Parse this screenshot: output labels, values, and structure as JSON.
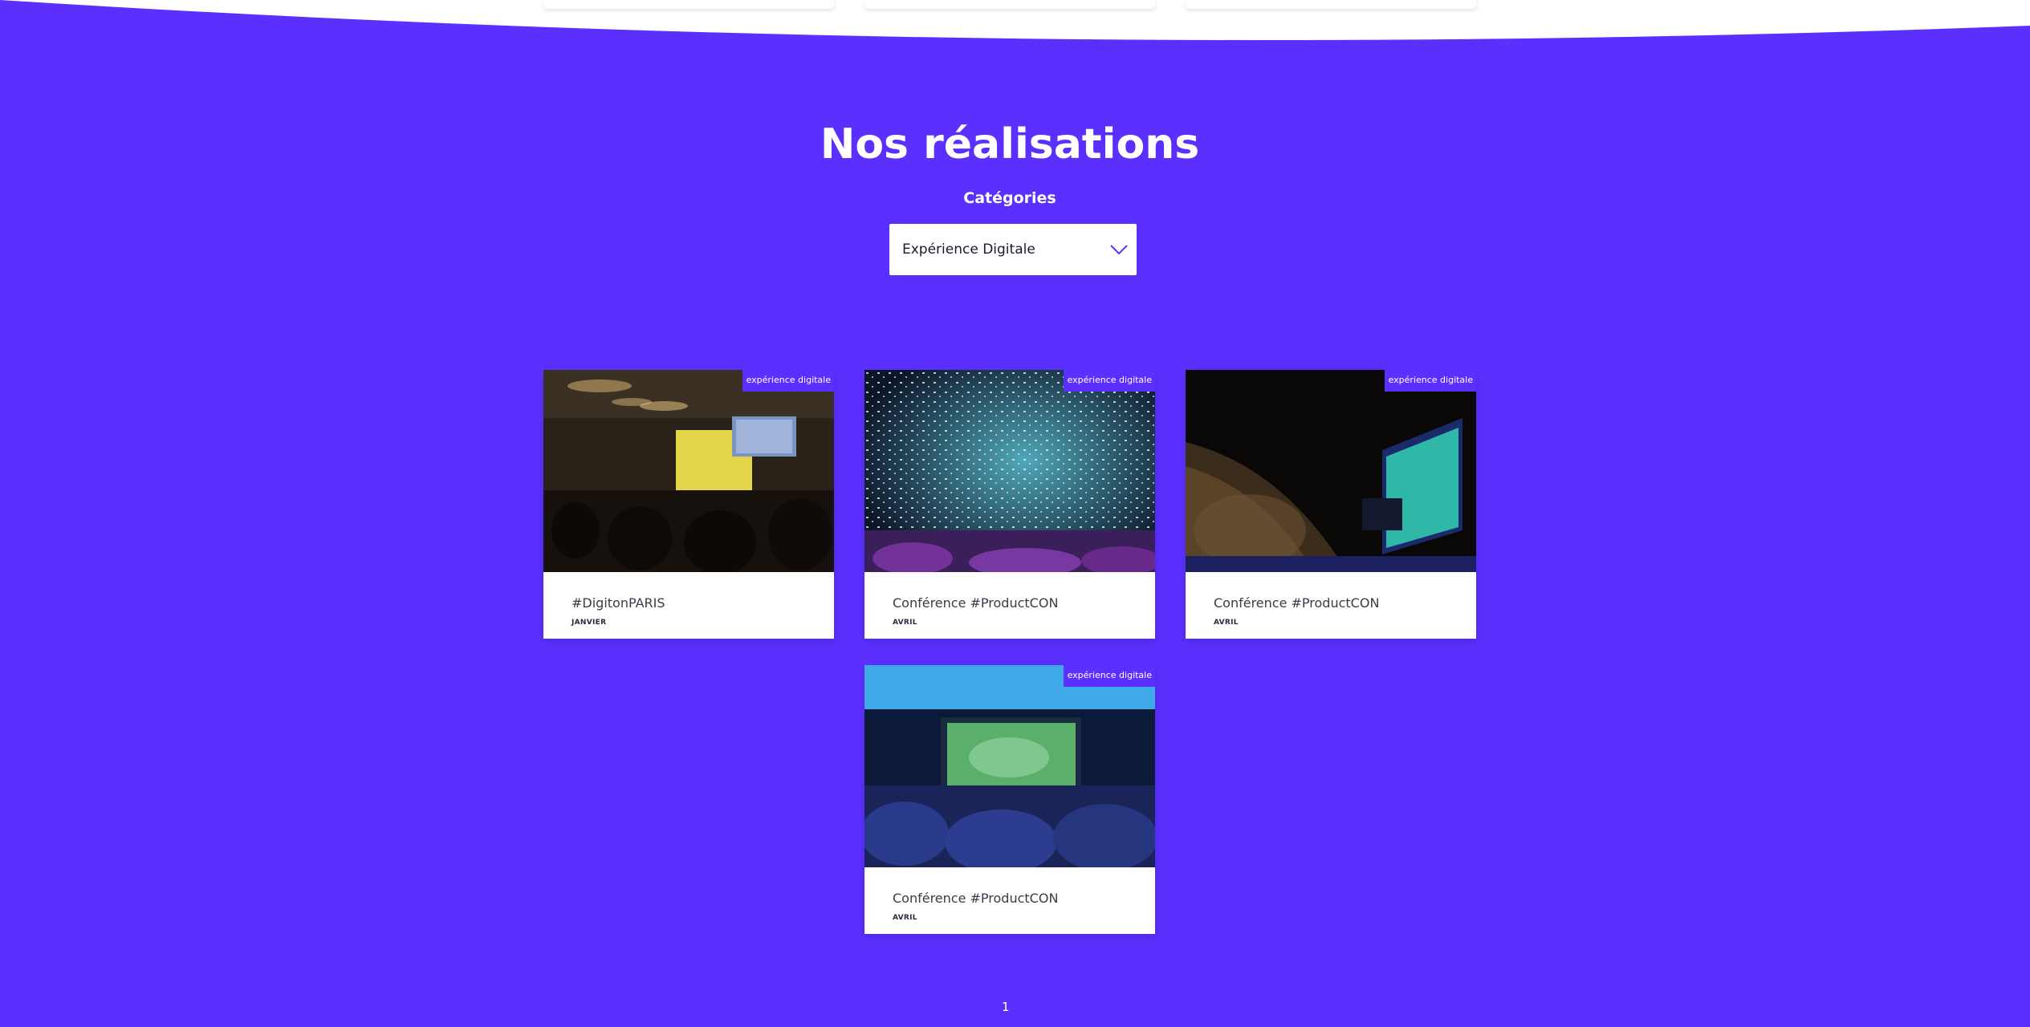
{
  "section": {
    "title": "Nos réalisations",
    "category_label": "Catégories",
    "category_selected": "Expérience Digitale"
  },
  "projects": [
    {
      "tag": "expérience digitale",
      "name": "#DigitonPARIS",
      "date": "JANVIER",
      "image": "conference-room-photo"
    },
    {
      "tag": "expérience digitale",
      "name": "Conférence #ProductCON",
      "date": "AVRIL",
      "image": "confetti-crowd-photo"
    },
    {
      "tag": "expérience digitale",
      "name": "Conférence #ProductCON",
      "date": "AVRIL",
      "image": "auditorium-stage-photo"
    },
    {
      "tag": "expérience digitale",
      "name": "Conférence #ProductCON",
      "date": "AVRIL",
      "image": "screen-audience-photo"
    }
  ],
  "pagination": {
    "current": "1"
  },
  "colors": {
    "accent": "#5b30ff",
    "card": "#ffffff"
  }
}
